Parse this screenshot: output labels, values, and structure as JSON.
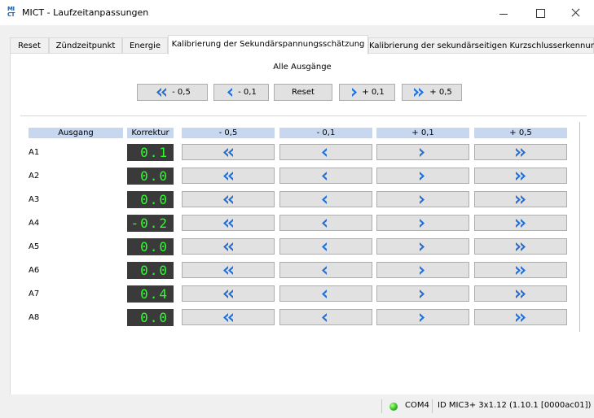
{
  "window": {
    "logo_top": "MI",
    "logo_bottom": "CT",
    "title": "MICT - Laufzeitanpassungen"
  },
  "tabs": [
    {
      "label": "Reset"
    },
    {
      "label": "Zündzeitpunkt"
    },
    {
      "label": "Energie"
    },
    {
      "label": "Kalibrierung der Sekundärspannungsschätzung",
      "active": true
    },
    {
      "label": "Kalibrierung der sekundärseitigen Kurzschlusserkennung"
    }
  ],
  "all_outputs": {
    "label": "Alle Ausgänge",
    "buttons": [
      {
        "label": "- 0,5",
        "icon": "double-chevron-left-icon"
      },
      {
        "label": "- 0,1",
        "icon": "chevron-left-icon"
      },
      {
        "label": "Reset"
      },
      {
        "label": "+ 0,1",
        "icon": "chevron-right-icon"
      },
      {
        "label": "+ 0,5",
        "icon": "double-chevron-right-icon"
      }
    ]
  },
  "table": {
    "headers": [
      "Ausgang",
      "Korrektur",
      "- 0,5",
      "- 0,1",
      "+ 0,1",
      "+ 0,5"
    ],
    "rows": [
      {
        "label": "A1",
        "value": "0.1"
      },
      {
        "label": "A2",
        "value": "0.0"
      },
      {
        "label": "A3",
        "value": "0.0"
      },
      {
        "label": "A4",
        "value": "-0.2"
      },
      {
        "label": "A5",
        "value": "0.0"
      },
      {
        "label": "A6",
        "value": "0.0"
      },
      {
        "label": "A7",
        "value": "0.4"
      },
      {
        "label": "A8",
        "value": "0.0"
      }
    ]
  },
  "status": {
    "port": "COM4",
    "device": "ID MIC3+ 3x1.12 (1.10.1 [0000ac01])",
    "led_color": "#30c020"
  },
  "colors": {
    "accent": "#1e6fd9",
    "header_bg": "#c8d7f0",
    "lcd_bg": "#3a3a3a",
    "lcd_text": "#2cff2c"
  }
}
